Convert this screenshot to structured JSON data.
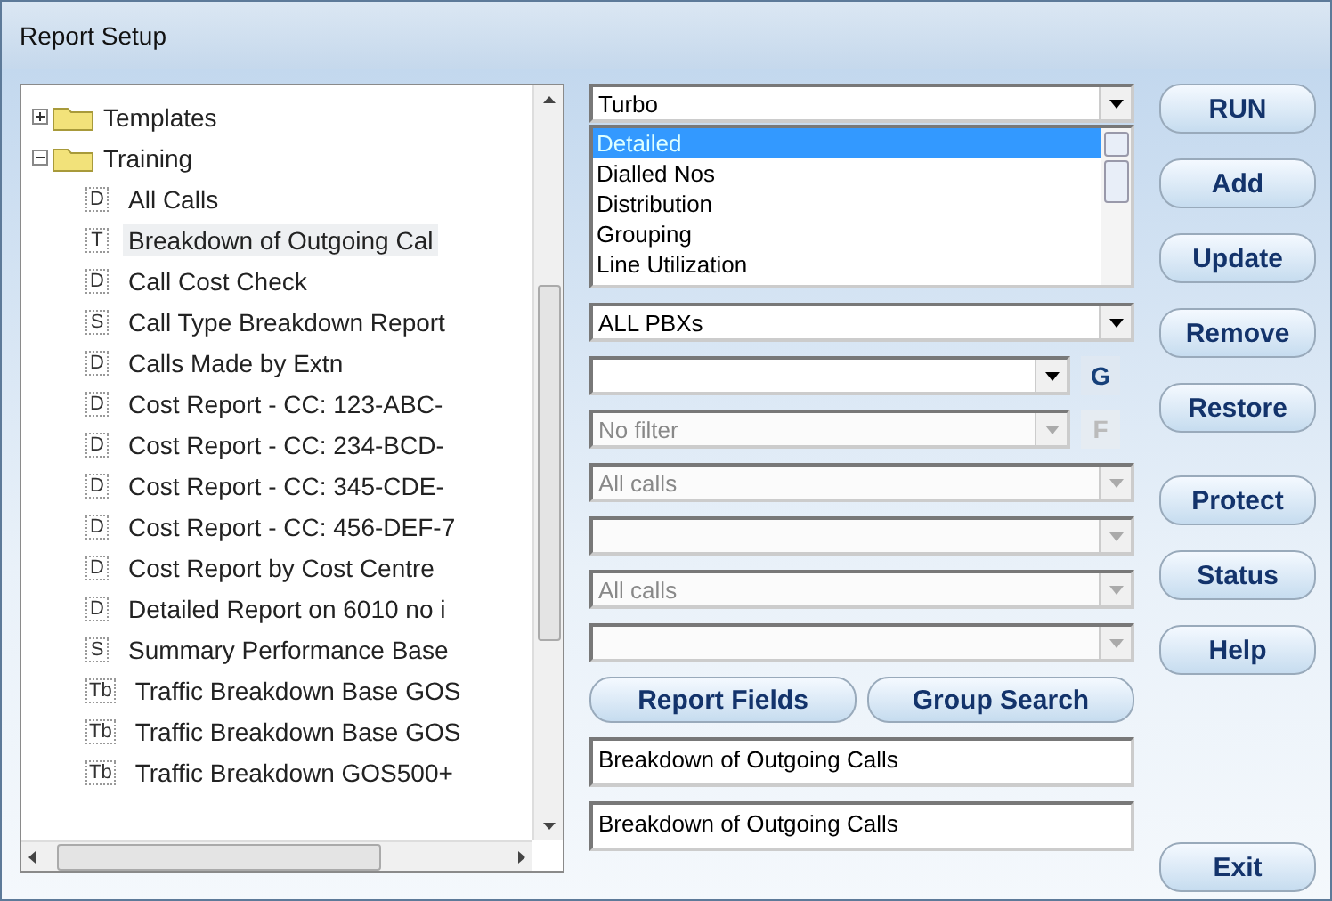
{
  "window": {
    "title": "Report Setup"
  },
  "tree": {
    "items": [
      {
        "label": "Templates",
        "expanded": false,
        "kind": "folder"
      },
      {
        "label": "Training",
        "expanded": true,
        "kind": "folder",
        "children": [
          {
            "kind": "report",
            "tag": "D",
            "label": "All Calls",
            "selected": false
          },
          {
            "kind": "report",
            "tag": "T",
            "label": "Breakdown of Outgoing Cal",
            "selected": true
          },
          {
            "kind": "report",
            "tag": "D",
            "label": "Call Cost Check",
            "selected": false
          },
          {
            "kind": "report",
            "tag": "S",
            "label": "Call Type Breakdown Report",
            "selected": false
          },
          {
            "kind": "report",
            "tag": "D",
            "label": "Calls Made by Extn",
            "selected": false
          },
          {
            "kind": "report",
            "tag": "D",
            "label": "Cost Report - CC: 123-ABC-",
            "selected": false
          },
          {
            "kind": "report",
            "tag": "D",
            "label": "Cost Report - CC: 234-BCD-",
            "selected": false
          },
          {
            "kind": "report",
            "tag": "D",
            "label": "Cost Report - CC: 345-CDE-",
            "selected": false
          },
          {
            "kind": "report",
            "tag": "D",
            "label": "Cost Report - CC: 456-DEF-7",
            "selected": false
          },
          {
            "kind": "report",
            "tag": "D",
            "label": "Cost Report by Cost Centre",
            "selected": false
          },
          {
            "kind": "report",
            "tag": "D",
            "label": "Detailed Report on 6010 no i",
            "selected": false
          },
          {
            "kind": "report",
            "tag": "S",
            "label": "Summary Performance Base",
            "selected": false
          },
          {
            "kind": "report",
            "tag": "Tb",
            "label": "Traffic Breakdown Base GOS",
            "selected": false
          },
          {
            "kind": "report",
            "tag": "Tb",
            "label": "Traffic Breakdown Base GOS",
            "selected": false
          },
          {
            "kind": "report",
            "tag": "Tb",
            "label": "Traffic Breakdown GOS500+",
            "selected": false
          }
        ]
      }
    ]
  },
  "report_type": {
    "value": "Turbo"
  },
  "type_list": [
    {
      "label": "Detailed",
      "selected": true
    },
    {
      "label": "Dialled Nos",
      "selected": false
    },
    {
      "label": "Distribution",
      "selected": false
    },
    {
      "label": "Grouping",
      "selected": false
    },
    {
      "label": "Line Utilization",
      "selected": false
    }
  ],
  "filters": [
    {
      "value": "ALL PBXs",
      "disabled": false
    },
    {
      "disabled": false,
      "side_button": "G"
    },
    {
      "value": "No filter",
      "disabled": true,
      "side_button": "F"
    },
    {
      "value": "All calls",
      "disabled": true
    },
    {
      "disabled": true
    },
    {
      "value": "All calls",
      "disabled": true
    },
    {
      "disabled": true
    }
  ],
  "middle_buttons": [
    "Report Fields",
    "Group Search"
  ],
  "text_fields": [
    "Breakdown of Outgoing Calls",
    "Breakdown of Outgoing Calls"
  ],
  "side_buttons": [
    "RUN",
    "Add",
    "Update",
    "Remove",
    "Restore",
    "Protect",
    "Status",
    "Help",
    "Exit"
  ]
}
